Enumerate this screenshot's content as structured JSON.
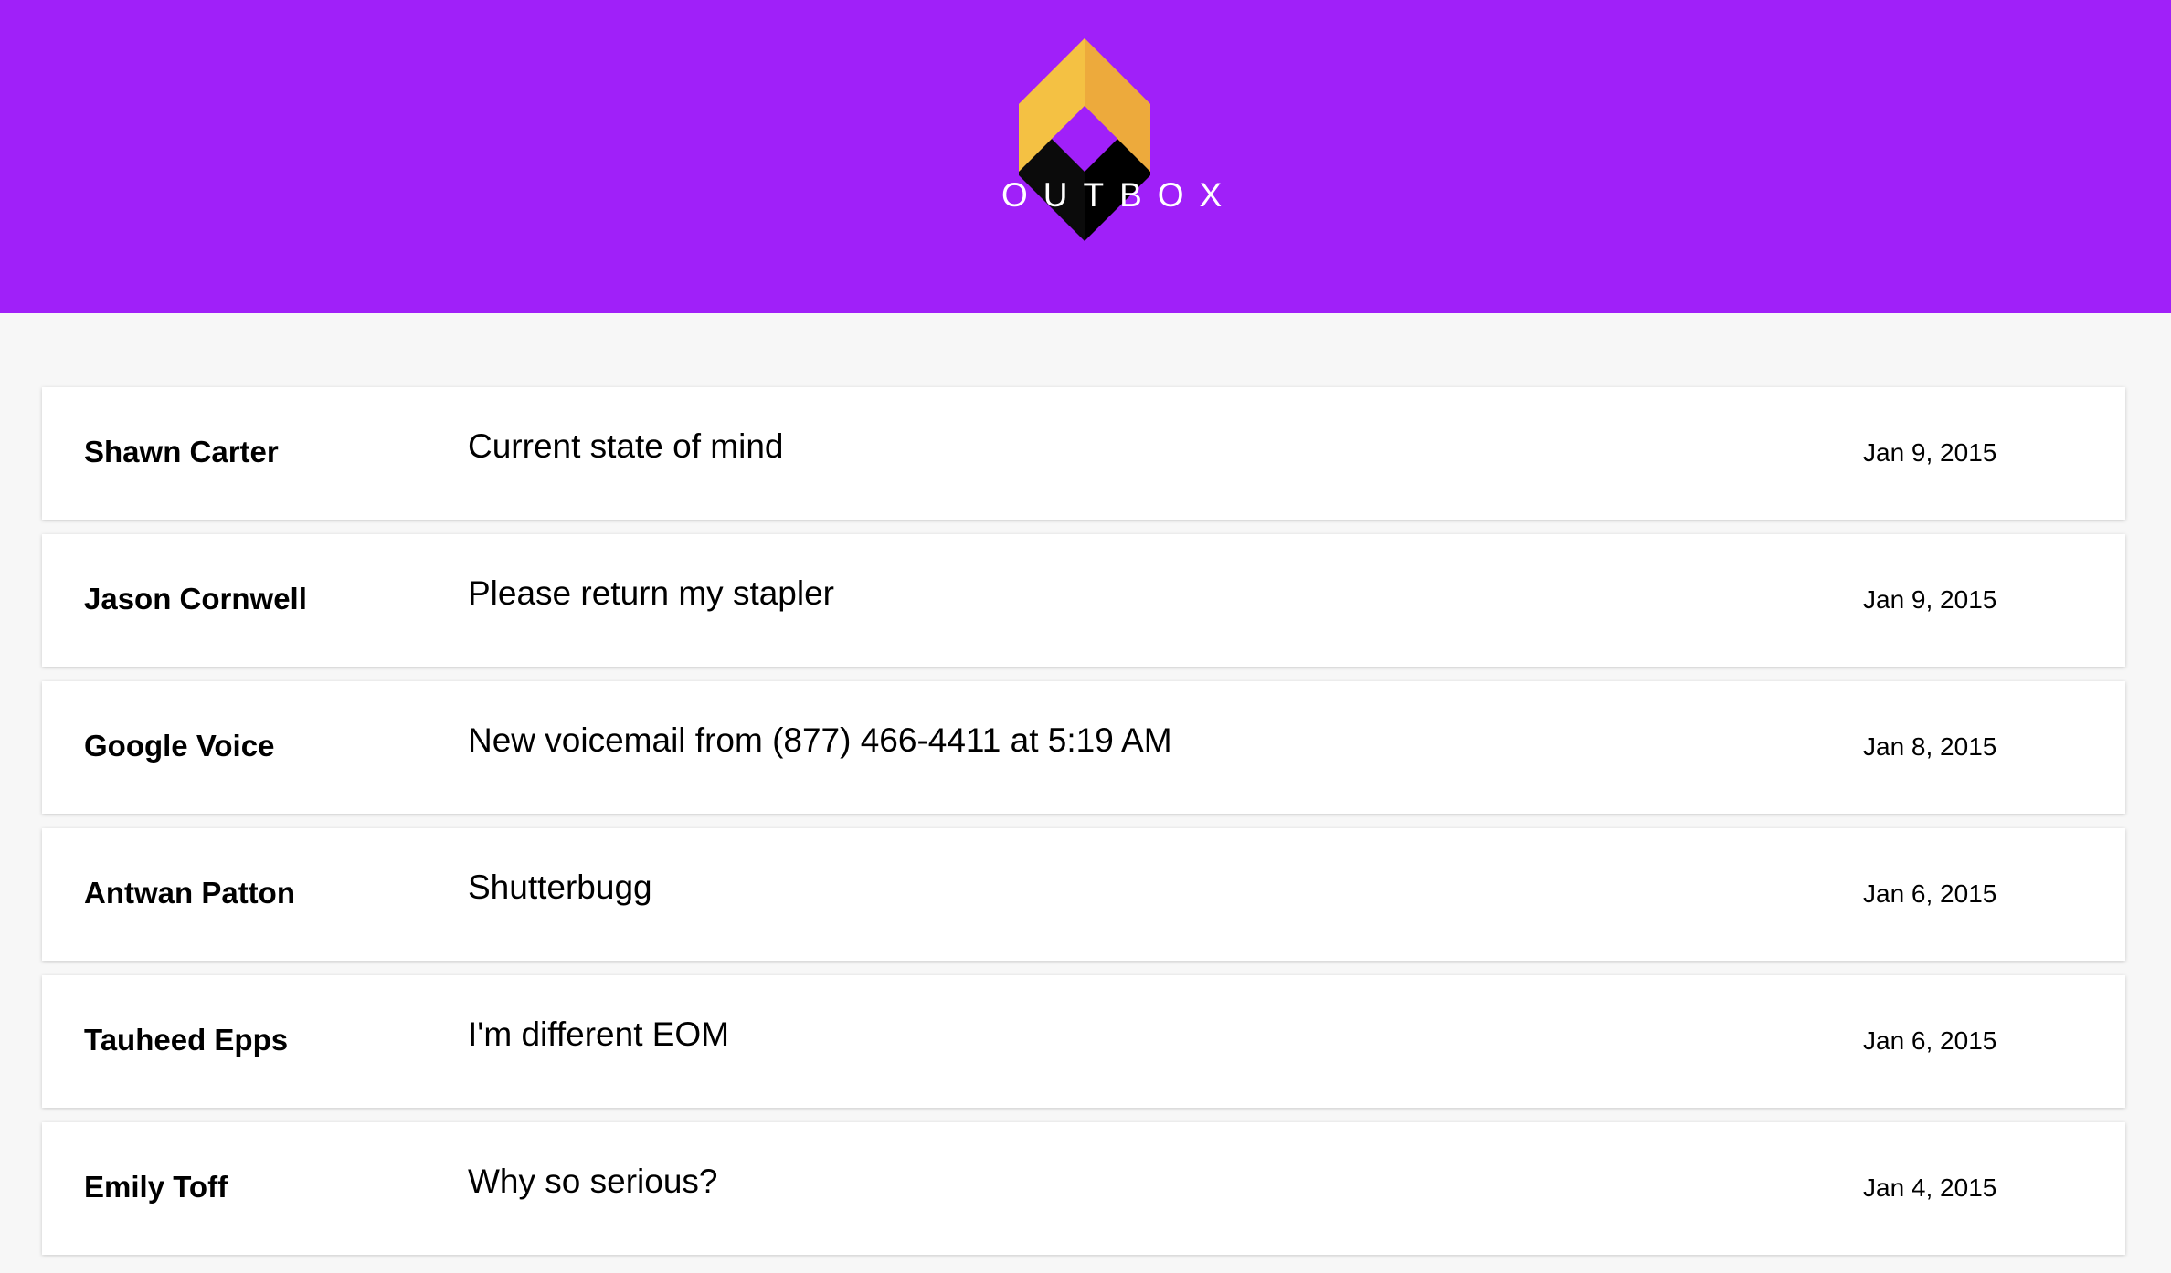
{
  "app": {
    "brand": "OUTBOX",
    "header_color": "#a020f9",
    "logo_colors": {
      "top_left": "#f4c143",
      "top_right": "#edaa3c",
      "bottom_left": "#0b0b0b",
      "bottom_right": "#000000"
    }
  },
  "messages": [
    {
      "sender": "Shawn Carter",
      "subject": "Current state of mind",
      "date": "Jan 9, 2015"
    },
    {
      "sender": "Jason Cornwell",
      "subject": "Please return my stapler",
      "date": "Jan 9, 2015"
    },
    {
      "sender": "Google Voice",
      "subject": "New voicemail from (877) 466-4411 at 5:19 AM",
      "date": "Jan 8, 2015"
    },
    {
      "sender": "Antwan Patton",
      "subject": "Shutterbugg",
      "date": "Jan 6, 2015"
    },
    {
      "sender": "Tauheed Epps",
      "subject": "I'm different EOM",
      "date": "Jan 6, 2015"
    },
    {
      "sender": "Emily Toff",
      "subject": "Why so serious?",
      "date": "Jan 4, 2015"
    }
  ]
}
